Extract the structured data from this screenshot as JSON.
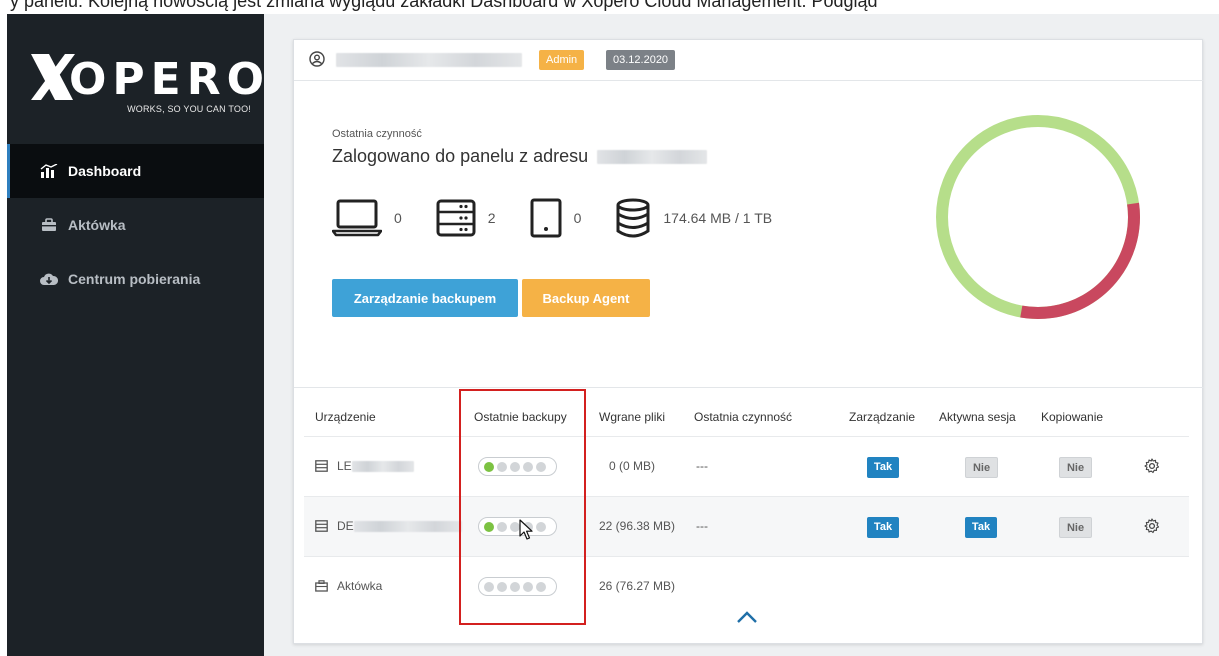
{
  "top_caption": "y panelu. Kolejną nowością jest zmiana wyglądu zakładki Dashboard w Xopero Cloud Management. Podgląd",
  "brand": {
    "logo_text": "OPERO",
    "tagline": "WORKS, SO YOU CAN TOO!"
  },
  "sidebar": {
    "items": [
      {
        "label": "Dashboard",
        "icon": "dashboard-chart-icon",
        "active": true
      },
      {
        "label": "Aktówka",
        "icon": "briefcase-icon",
        "active": false
      },
      {
        "label": "Centrum pobierania",
        "icon": "cloud-download-icon",
        "active": false
      }
    ]
  },
  "header": {
    "user_name": "",
    "role_badge": "Admin",
    "date_badge": "03.12.2020"
  },
  "activity": {
    "label": "Ostatnia czynność",
    "text": "Zalogowano do panelu z adresu"
  },
  "stats": [
    {
      "icon": "laptop-icon",
      "value": "0"
    },
    {
      "icon": "server-icon",
      "value": "2"
    },
    {
      "icon": "tablet-icon",
      "value": "0"
    },
    {
      "icon": "database-icon",
      "value": "174.64 MB / 1 TB"
    }
  ],
  "buttons": {
    "manage": "Zarządzanie backupem",
    "agent": "Backup Agent"
  },
  "storage_ring": {
    "used_fraction_red": 0.3,
    "colors": {
      "free": "#b6de8a",
      "used": "#c9485f"
    }
  },
  "table": {
    "headers": [
      "Urządzenie",
      "Ostatnie backupy",
      "Wgrane pliki",
      "Ostatnia czynność",
      "Zarządzanie",
      "Aktywna sesja",
      "Kopiowanie"
    ],
    "rows": [
      {
        "icon": "server-row-icon",
        "name": "LE",
        "backups": [
          1,
          0,
          0,
          0,
          0
        ],
        "files": "0 (0 MB)",
        "activity": "---",
        "manage": "Tak",
        "session": "Nie",
        "copy": "Nie",
        "has_gear": true
      },
      {
        "icon": "server-row-icon",
        "name": "DE",
        "backups": [
          1,
          0,
          0,
          0,
          0
        ],
        "files": "22 (96.38 MB)",
        "activity": "---",
        "manage": "Tak",
        "session": "Tak",
        "copy": "Nie",
        "has_gear": true
      },
      {
        "icon": "briefcase-row-icon",
        "name": "Aktówka",
        "backups": [
          0,
          0,
          0,
          0,
          0
        ],
        "files": "26 (76.27 MB)",
        "activity": "",
        "manage": "",
        "session": "",
        "copy": "",
        "has_gear": false
      }
    ]
  },
  "colors": {
    "sidebar_bg": "#1c2227",
    "accent_blue": "#3ea2d7",
    "accent_orange": "#f5b246",
    "highlight_red": "#d3201f"
  }
}
